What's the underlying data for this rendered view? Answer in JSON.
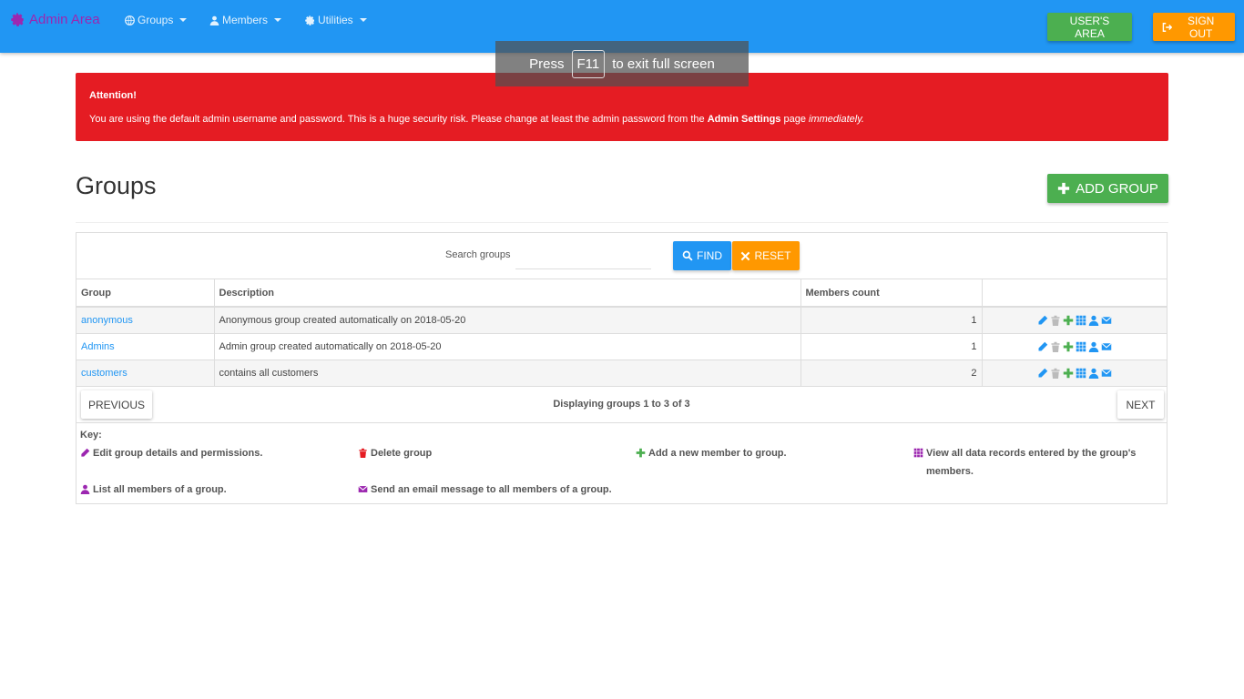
{
  "navbar": {
    "brand": "Admin Area",
    "menus": [
      {
        "label": "Groups",
        "icon": "globe-icon"
      },
      {
        "label": "Members",
        "icon": "user-icon"
      },
      {
        "label": "Utilities",
        "icon": "cog-icon"
      }
    ],
    "users_area": "USER'S AREA",
    "sign_out": "SIGN OUT"
  },
  "fullscreen_hint": {
    "before": "Press",
    "key": "F11",
    "after": "to exit full screen"
  },
  "alert": {
    "title": "Attention!",
    "text_1": "You are using the default admin username and password. This is a huge security risk. Please change at least the admin password from the",
    "link": "Admin Settings",
    "text_2": "page",
    "emphasis": "immediately."
  },
  "page": {
    "title": "Groups",
    "add_button": "ADD GROUP"
  },
  "search": {
    "label": "Search groups",
    "value": "",
    "find": "FIND",
    "reset": "RESET"
  },
  "table": {
    "headers": {
      "group": "Group",
      "description": "Description",
      "members_count": "Members count"
    },
    "rows": [
      {
        "group": "anonymous",
        "description": "Anonymous group created automatically on 2018-05-20",
        "count": "1"
      },
      {
        "group": "Admins",
        "description": "Admin group created automatically on 2018-05-20",
        "count": "1"
      },
      {
        "group": "customers",
        "description": "contains all customers",
        "count": "2"
      }
    ]
  },
  "pager": {
    "previous": "PREVIOUS",
    "status": "Displaying groups 1 to 3 of 3",
    "next": "NEXT"
  },
  "key": {
    "title": "Key:",
    "edit": "Edit group details and permissions.",
    "delete": "Delete group",
    "add_member": "Add a new member to group.",
    "view_records": "View all data records entered by the group's members.",
    "list_members": "List all members of a group.",
    "email": "Send an email message to all members of a group."
  },
  "colors": {
    "navbar": "#2196f3",
    "brand": "#9c27b0",
    "alert": "#e51c23",
    "success": "#4caf50",
    "warning": "#ff9800",
    "primary": "#2196f3"
  }
}
